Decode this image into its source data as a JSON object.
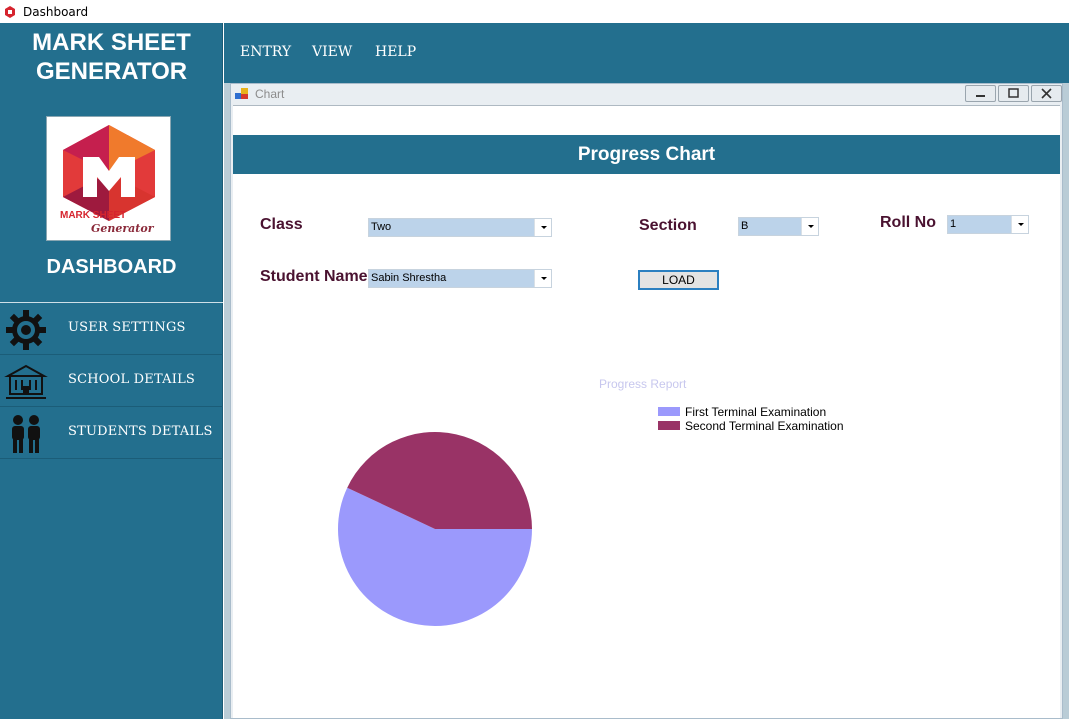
{
  "window": {
    "title": "Dashboard"
  },
  "sidebar": {
    "brand_line1": "MARK SHEET",
    "brand_line2": "GENERATOR",
    "logo_text1": "MARK SHEET",
    "logo_text2": "Generator",
    "dashboard_label": "DASHBOARD",
    "items": [
      {
        "label": "USER SETTINGS",
        "icon": "gear-icon"
      },
      {
        "label": "SCHOOL DETAILS",
        "icon": "school-building-icon"
      },
      {
        "label": "STUDENTS DETAILS",
        "icon": "students-icon"
      }
    ]
  },
  "menu": {
    "entry": "ENTRY",
    "view": "VIEW",
    "help": "HELP"
  },
  "child_window": {
    "title": "Chart"
  },
  "form": {
    "banner": "Progress Chart",
    "class_label": "Class",
    "class_value": "Two",
    "section_label": "Section",
    "section_value": "B",
    "roll_label": "Roll No",
    "roll_value": "1",
    "student_label": "Student Name",
    "student_value": "Sabin Shrestha",
    "load_button": "LOAD"
  },
  "chart_data": {
    "type": "pie",
    "title": "Progress Report",
    "legend_position": "top-right",
    "series": [
      {
        "name": "First Terminal Examination",
        "value": 57,
        "color": "#9b99fc"
      },
      {
        "name": "Second Terminal Examination",
        "value": 43,
        "color": "#993366"
      }
    ]
  },
  "colors": {
    "primary": "#236f8e",
    "label": "#4a1230",
    "combo": "#bcd3ea"
  }
}
